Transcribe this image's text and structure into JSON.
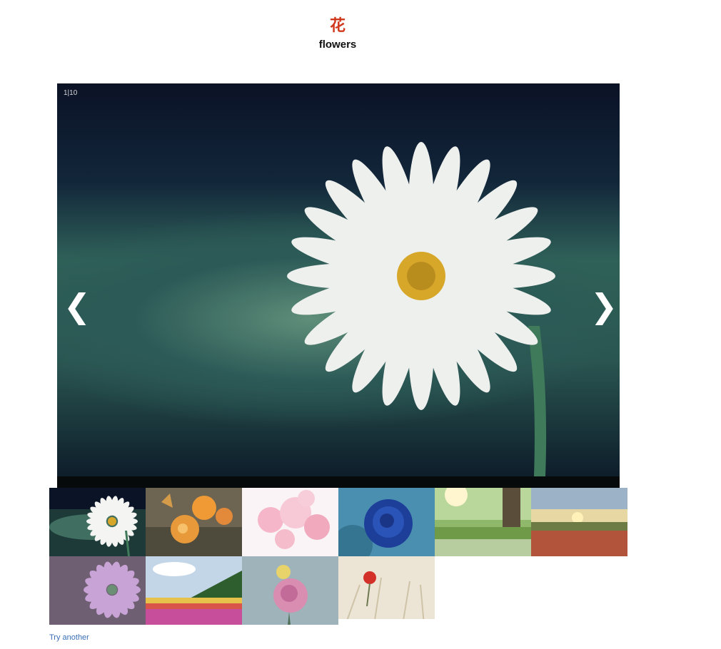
{
  "header": {
    "kanji": "花",
    "word": "flowers"
  },
  "viewer": {
    "counter": "1|10",
    "prev_icon": "chevron-left-icon",
    "prev_glyph": "❮",
    "next_icon": "chevron-right-icon",
    "next_glyph": "❯",
    "current_image": "white-daisy"
  },
  "thumbnails": [
    {
      "subject": "white-daisy"
    },
    {
      "subject": "orange-flowers-butterfly"
    },
    {
      "subject": "pink-cherry-blossom"
    },
    {
      "subject": "blue-rose"
    },
    {
      "subject": "sunny-meadow"
    },
    {
      "subject": "poppy-field-sunset"
    },
    {
      "subject": "purple-daisy"
    },
    {
      "subject": "flower-field-trees"
    },
    {
      "subject": "pink-rose"
    },
    {
      "subject": "red-poppy-grass"
    }
  ],
  "footer": {
    "try_another": "Try another"
  },
  "colors": {
    "kanji": "#d0391d",
    "link": "#3a6fb7",
    "daisy_center": "#d7a72a"
  }
}
